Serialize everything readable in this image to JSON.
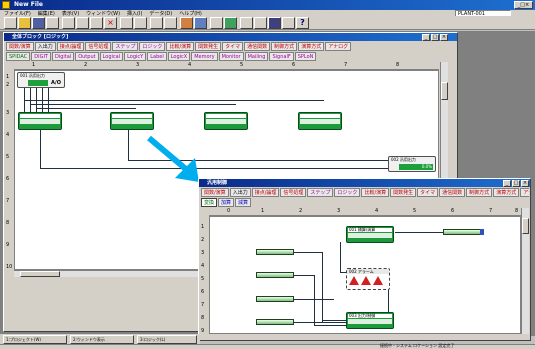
{
  "app": {
    "title": "New File",
    "menu": [
      "ファイル(F)",
      "編集(E)",
      "表示(V)",
      "ウィンドウ(W)",
      "挿入(I)",
      "データ(D)",
      "ヘルプ(H)"
    ],
    "top_right_field": "PLANT-001",
    "statusbar": "接続中 - システム ロケーション 設定完了",
    "title_controls": [
      "_",
      "□",
      "×"
    ]
  },
  "back_window": {
    "title": "全体ブロック [ロジック]",
    "tabs_row1": [
      "関数/演算",
      "入出力",
      "接点/論理",
      "信号処理",
      "ステップ",
      "ロジック",
      "比較/演算",
      "関数発生",
      "タイマ",
      "通信関数",
      "制御方式",
      "演算方式",
      "アナログ"
    ],
    "tabs_row2": [
      "SPIDAC",
      "DIGIT",
      "Digital",
      "Output",
      "Logical",
      "LogicY",
      "Label",
      "LogicX",
      "Memory",
      "Monitor",
      "Mailing",
      "SignalF",
      "SPLoN",
      "Station",
      "Trending",
      "Display",
      "Utility"
    ],
    "ruler": [
      "1",
      "2",
      "3",
      "4",
      "5",
      "6",
      "7",
      "8"
    ],
    "row_numbers": [
      "1",
      "2",
      "3",
      "4",
      "5",
      "6",
      "7",
      "8",
      "9",
      "10"
    ],
    "ao_label": "A/O",
    "ao_header": "001 汎用出力",
    "out_header": "002 汎用出力",
    "out_value": "0.0%"
  },
  "front_window": {
    "title": "汎用制御",
    "tabs_row1": [
      "関数/演算",
      "入出力",
      "接点/論理",
      "信号処理",
      "ステップ",
      "ロジック",
      "比較/演算",
      "関数発生",
      "タイマ",
      "通信関数",
      "制御方式",
      "演算方式",
      "アナログ"
    ],
    "tabs_row2": [
      "変換",
      "加算",
      "減算"
    ],
    "ruler": [
      "0",
      "1",
      "2",
      "3",
      "4",
      "5",
      "6",
      "7",
      "8"
    ],
    "row_numbers": [
      "1",
      "2",
      "3",
      "4",
      "5",
      "6",
      "7",
      "8",
      "9"
    ],
    "block_top": "001 積算/演算",
    "block_mid": "002 アラーム",
    "block_bottom": "003 出力/制御"
  },
  "taskbar": {
    "items": [
      "1:プロジェクト(W)",
      "2:ウィンドウ表示",
      "3:ロジック(L)"
    ]
  },
  "colors": {
    "arrow": "#00aeef",
    "node_green": "#1c9a3c",
    "title_blue": "#0a2a8a"
  }
}
